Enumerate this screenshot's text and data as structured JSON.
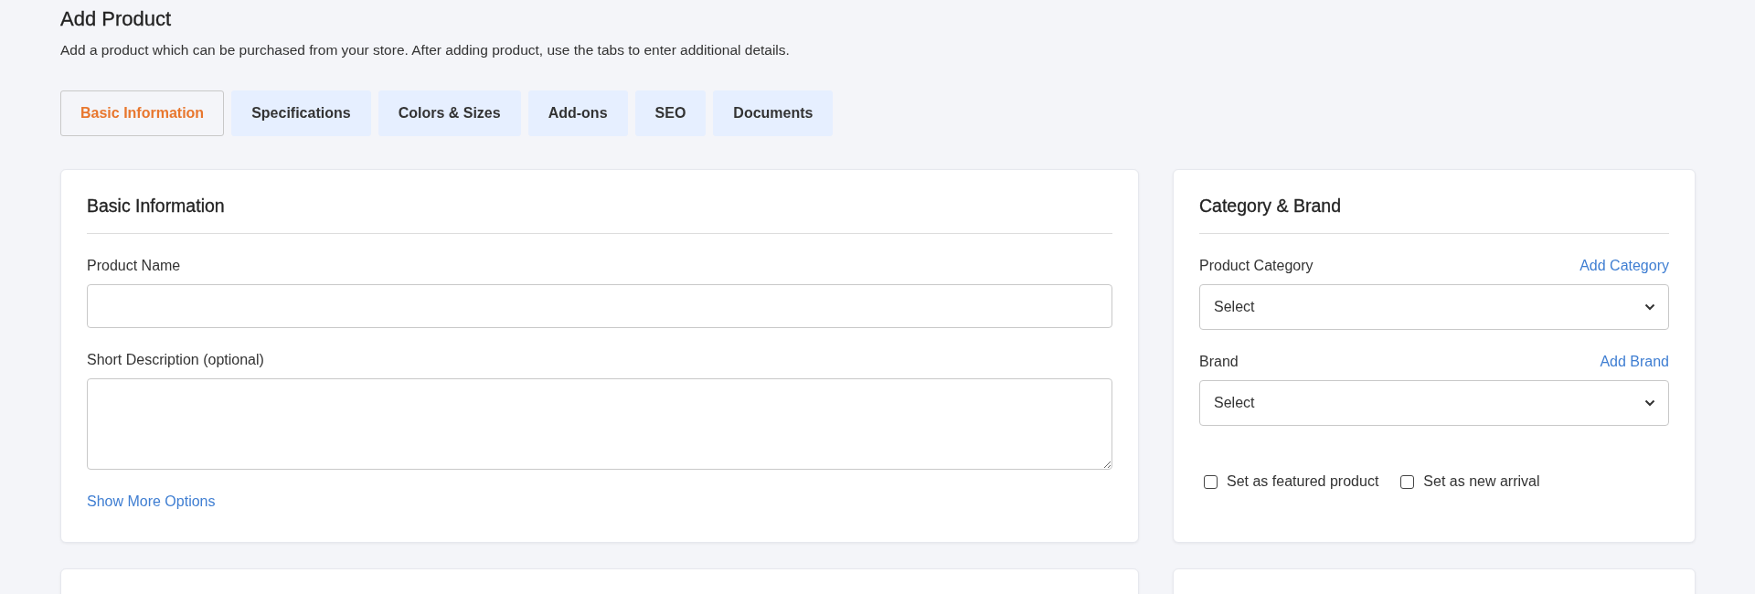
{
  "page": {
    "title": "Add Product",
    "subtitle": "Add a product which can be purchased from your store. After adding product, use the tabs to enter additional details."
  },
  "tabs": [
    {
      "label": "Basic Information",
      "selected": true
    },
    {
      "label": "Specifications",
      "selected": false
    },
    {
      "label": "Colors & Sizes",
      "selected": false
    },
    {
      "label": "Add-ons",
      "selected": false
    },
    {
      "label": "SEO",
      "selected": false
    },
    {
      "label": "Documents",
      "selected": false
    }
  ],
  "basic_information": {
    "title": "Basic Information",
    "fields": [
      {
        "kind": "text",
        "label": "Product Name"
      },
      {
        "kind": "textarea",
        "label": "Short Description (optional)"
      }
    ],
    "link": "Show More Options"
  },
  "category_brand": {
    "title": "Category & Brand",
    "selects": [
      {
        "label": "Product Category",
        "link": "Add Category",
        "value": "Select"
      },
      {
        "label": "Brand",
        "link": "Add Brand",
        "value": "Select"
      }
    ],
    "checkboxes": [
      {
        "label": "Set as featured product",
        "checked": false
      },
      {
        "label": "Set as new arrival",
        "checked": false
      }
    ]
  }
}
